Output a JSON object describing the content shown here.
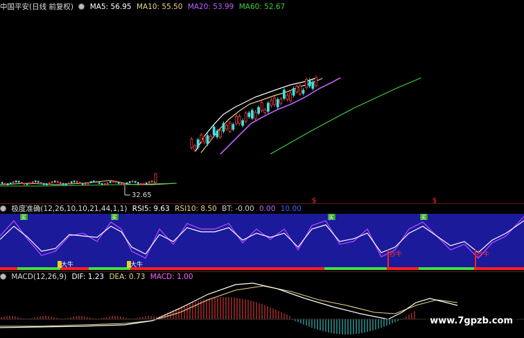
{
  "price_panel": {
    "title": "中国平安(日线 前复权)",
    "ma5": "MA5: 56.95",
    "ma10": "MA10: 55.50",
    "ma20": "MA20: 53.99",
    "ma60": "MA60: 52.67",
    "low_label": "32.65",
    "colors": {
      "ma5": "#ffffff",
      "ma10": "#e8d68a",
      "ma20": "#c060ff",
      "ma60": "#40d040"
    }
  },
  "indicator_panel": {
    "title": "极度准确(12,26,10,10,21,44,1,1)",
    "rsi5": "RSI5: 9.63",
    "rsi10": "RSI10: 8.50",
    "bt": "BT: -0.00",
    "bt2": "0.00",
    "bt3": "10.00",
    "buy_tag": "买",
    "bull_tag": "大牛",
    "jt_tag": "抄牛",
    "dollar_mark": "$",
    "colors": {
      "panel_bg": "#1a1a9a",
      "rsi5": "#ffffff",
      "rsi10": "#b040ff"
    }
  },
  "macd_panel": {
    "title": "MACD(12,26,9)",
    "dif": "DIF: 1.23",
    "dea": "DEA: 0.73",
    "macd": "MACD: 1.00",
    "colors": {
      "dif": "#ffffff",
      "dea": "#e8d68a",
      "macd": "#ff60ff"
    }
  },
  "watermark": "www.7gpzb.com"
}
